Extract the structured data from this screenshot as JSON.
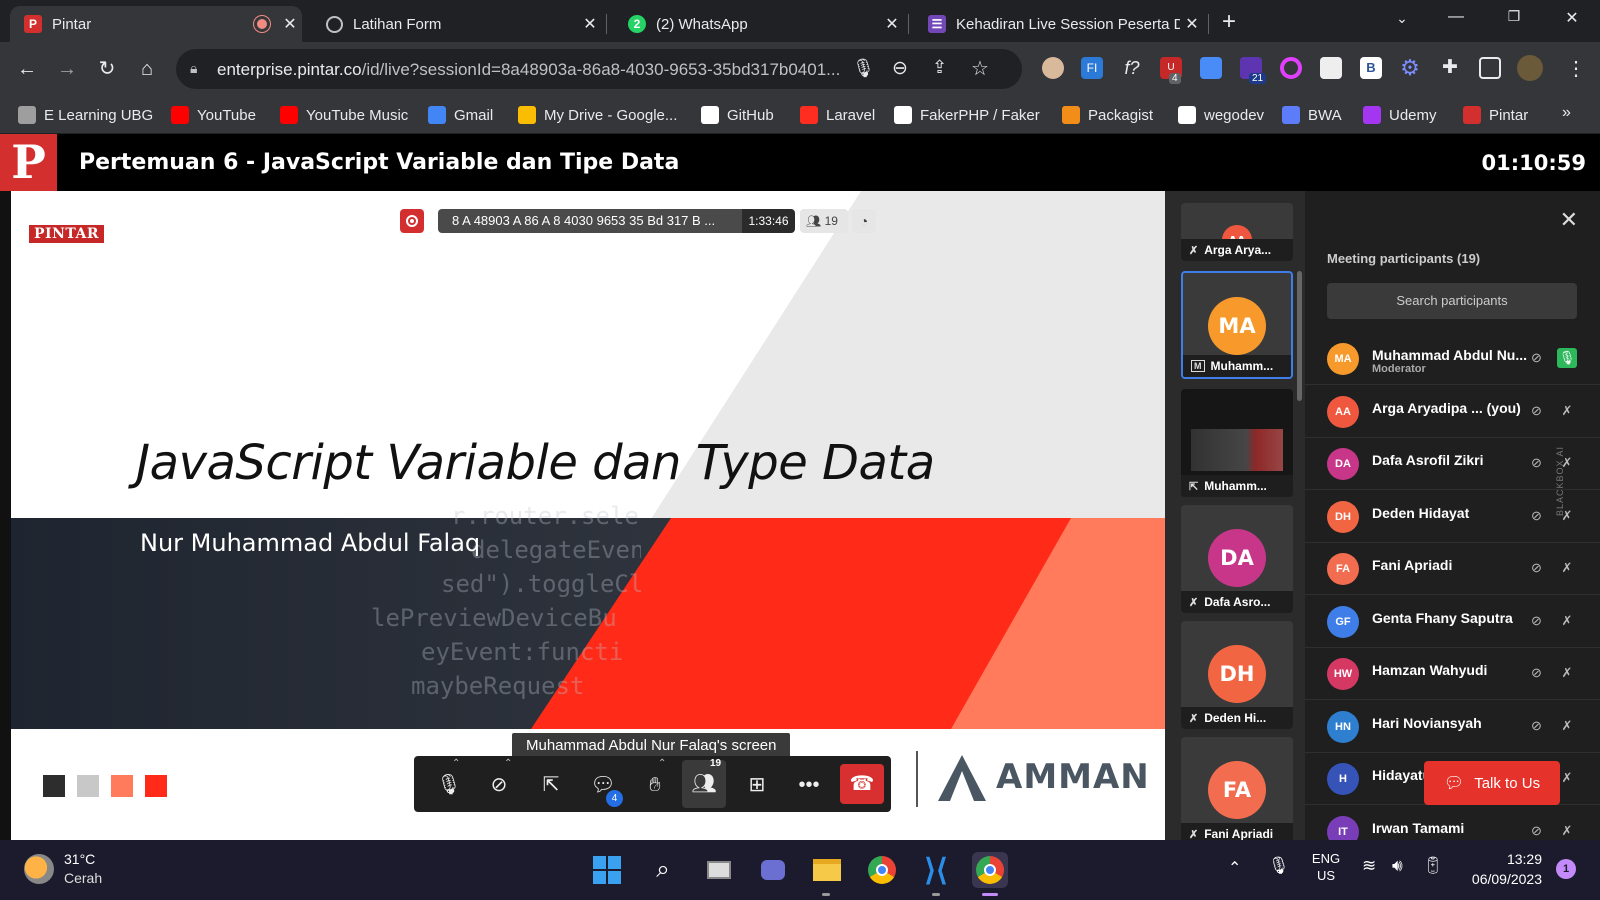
{
  "browser": {
    "tabs": [
      {
        "title": "Pintar",
        "favicon_letter": "P",
        "favicon_color": "#d32f2f",
        "recording": true,
        "active": true
      },
      {
        "title": "Latihan Form",
        "favicon_letter": "",
        "favicon_color": "#5f6368",
        "active": false
      },
      {
        "title": "(2) WhatsApp",
        "favicon_letter": "2",
        "favicon_color": "#25d366",
        "active": false
      },
      {
        "title": "Kehadiran Live Session Peserta D",
        "favicon_letter": "",
        "favicon_color": "#7248b9",
        "active": false
      }
    ],
    "new_tab_icon": "plus-icon",
    "url_domain": "enterprise.pintar.co",
    "url_path": "/id/live?sessionId=8a48903a-86a8-4030-9653-35bd317b0401...",
    "extension_badges": {
      "ublock": "4",
      "purple": "21"
    }
  },
  "bookmarks": [
    {
      "label": "E Learning UBG",
      "icon": "ubg-icon",
      "color": "#9e9e9e"
    },
    {
      "label": "YouTube",
      "icon": "youtube-icon",
      "color": "#ff0000"
    },
    {
      "label": "YouTube Music",
      "icon": "youtube-music-icon",
      "color": "#ff0000"
    },
    {
      "label": "Gmail",
      "icon": "gmail-icon",
      "color": "#4285f4"
    },
    {
      "label": "My Drive - Google...",
      "icon": "google-drive-icon",
      "color": "#fbbc04"
    },
    {
      "label": "GitHub",
      "icon": "github-icon",
      "color": "#ffffff"
    },
    {
      "label": "Laravel",
      "icon": "laravel-icon",
      "color": "#ff2d20"
    },
    {
      "label": "FakerPHP / Faker",
      "icon": "faker-icon",
      "color": "#ffffff"
    },
    {
      "label": "Packagist",
      "icon": "packagist-icon",
      "color": "#f28d1a"
    },
    {
      "label": "wegodev",
      "icon": "wegodev-icon",
      "color": "#ffffff"
    },
    {
      "label": "BWA",
      "icon": "bwa-icon",
      "color": "#5c7cfa"
    },
    {
      "label": "Udemy",
      "icon": "udemy-icon",
      "color": "#a435f0"
    },
    {
      "label": "Pintar",
      "icon": "pintar-icon",
      "color": "#d32f2f"
    }
  ],
  "meeting": {
    "logo": "P",
    "title": "Pertemuan 6 - JavaScript Variable dan Tipe Data",
    "timer": "01:10:59",
    "session_label": "8 A 48903 A 86 A 8 4030 9653 35 Bd 317 B ...",
    "session_time": "1:33:46",
    "participant_count": "19",
    "screen_label": "Muhammad Abdul Nur Falaq's screen",
    "chat_badge": "4",
    "participants_badge": "19"
  },
  "slide": {
    "brand": "PINTAR",
    "title": "JavaScript Variable dan Type Data",
    "author": "Nur Muhammad Abdul Falaq",
    "sponsor": "AMMAN",
    "code_lines": [
      "r.router.sele",
      "delegateEven",
      "sed\").toggleCl",
      "lePreviewDeviceBu",
      "eyEvent:functi",
      "maybeRequest"
    ],
    "swatches": [
      "#2d2d2d",
      "#c8c8c8",
      "#ff7b5c",
      "#ff2a17"
    ]
  },
  "tiles": [
    {
      "initials": "AA",
      "name": "Arga Arya...",
      "color": "#f0573f",
      "mic_icon": "mic-off-icon"
    },
    {
      "initials": "MA",
      "name": "Muhamm...",
      "color": "#f79a2b",
      "mic_icon": "moderator-icon",
      "mic_label": "M"
    },
    {
      "initials": "",
      "name": "Muhamm...",
      "color": "#222222",
      "mic_icon": "screen-share-icon"
    },
    {
      "initials": "DA",
      "name": "Dafa Asro...",
      "color": "#c8368a",
      "mic_icon": "mic-off-icon"
    },
    {
      "initials": "DH",
      "name": "Deden Hi...",
      "color": "#f16543",
      "mic_icon": "mic-off-icon"
    },
    {
      "initials": "FA",
      "name": "Fani Apriadi",
      "color": "#f26c4f",
      "mic_icon": "mic-off-icon"
    }
  ],
  "participants_panel": {
    "title": "Meeting participants (19)",
    "search_placeholder": "Search participants",
    "talk_to_us": "Talk to Us",
    "rows": [
      {
        "initials": "MA",
        "name": "Muhammad Abdul Nu...",
        "role": "Moderator",
        "color": "#f79a2b",
        "mic_on": true
      },
      {
        "initials": "AA",
        "name": "Arga Aryadipa ...  (you)",
        "role": "",
        "color": "#f0573f",
        "mic_on": false
      },
      {
        "initials": "DA",
        "name": "Dafa Asrofil Zikri",
        "role": "",
        "color": "#c8368a",
        "mic_on": false
      },
      {
        "initials": "DH",
        "name": "Deden Hidayat",
        "role": "",
        "color": "#f16543",
        "mic_on": false
      },
      {
        "initials": "FA",
        "name": "Fani Apriadi",
        "role": "",
        "color": "#f26c4f",
        "mic_on": false
      },
      {
        "initials": "GF",
        "name": "Genta Fhany Saputra",
        "role": "",
        "color": "#3f7ee8",
        "mic_on": false
      },
      {
        "initials": "HW",
        "name": "Hamzan Wahyudi",
        "role": "",
        "color": "#d63864",
        "mic_on": false
      },
      {
        "initials": "HN",
        "name": "Hari Noviansyah",
        "role": "",
        "color": "#2f7fd1",
        "mic_on": false
      },
      {
        "initials": "H",
        "name": "Hidayatu",
        "role": "",
        "color": "#3654b8",
        "mic_on": false
      },
      {
        "initials": "IT",
        "name": "Irwan Tamami",
        "role": "",
        "color": "#7a3db8",
        "mic_on": false
      }
    ]
  },
  "taskbar": {
    "weather_temp": "31°C",
    "weather_desc": "Cerah",
    "lang": "ENG",
    "region": "US",
    "time": "13:29",
    "date": "06/09/2023",
    "notif_count": "1"
  },
  "side_text": "BLACKBOX AI"
}
